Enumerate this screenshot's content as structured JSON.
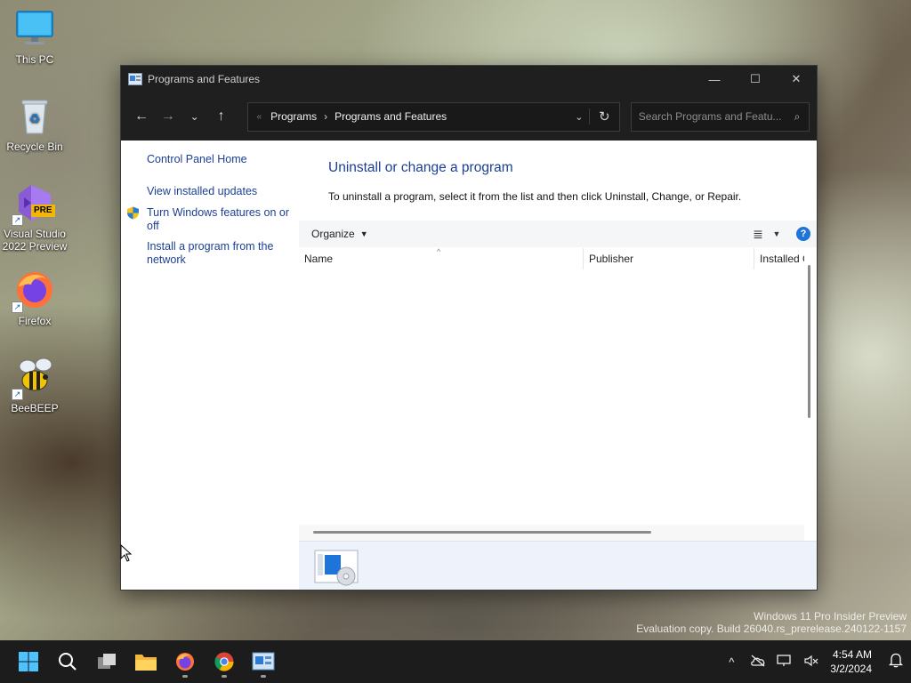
{
  "desktop": {
    "icons": [
      {
        "label": "This PC"
      },
      {
        "label": "Recycle Bin"
      },
      {
        "label": "Visual Studio 2022 Preview",
        "badge": "PRE"
      },
      {
        "label": "Firefox"
      },
      {
        "label": "BeeBEEP"
      }
    ]
  },
  "window": {
    "title": "Programs and Features",
    "controls": {
      "minimize": "—",
      "maximize": "☐",
      "close": "✕"
    }
  },
  "navigation": {
    "back": "←",
    "forward": "→",
    "recent": "⌄",
    "up": "↑",
    "breadcrumb": [
      "Programs",
      "Programs and Features"
    ],
    "breadcrumb_separator": "›",
    "overflow": "«",
    "dropdown": "⌄",
    "refresh": "↻",
    "search_placeholder": "Search Programs and Featu...",
    "search_icon": "⌕"
  },
  "sidebar": {
    "home": "Control Panel Home",
    "items": [
      {
        "label": "View installed updates"
      },
      {
        "label": "Turn Windows features on or off",
        "icon": "shield-icon"
      },
      {
        "label": "Install a program from the network"
      }
    ]
  },
  "main": {
    "title": "Uninstall or change a program",
    "description": "To uninstall a program, select it from the list and then click Uninstall, Change, or Repair.",
    "toolbar": {
      "organize": "Organize",
      "organize_caret": "▼",
      "view_icon": "≣",
      "view_caret": "▼",
      "help": "?"
    },
    "columns": [
      {
        "label": "Name"
      },
      {
        "label": "Publisher"
      },
      {
        "label": "Installed On"
      }
    ],
    "sort_indicator": "^"
  },
  "watermark": {
    "line1": "Windows 11 Pro Insider Preview",
    "line2": "Evaluation copy. Build 26040.rs_prerelease.240122-1157"
  },
  "taskbar": {
    "tray": {
      "chevron": "^",
      "time": "4:54 AM",
      "date": "3/2/2024"
    }
  },
  "colors": {
    "link": "#1c3f95",
    "titlebar": "#1f1f1f",
    "accent": "#1e74d8"
  }
}
